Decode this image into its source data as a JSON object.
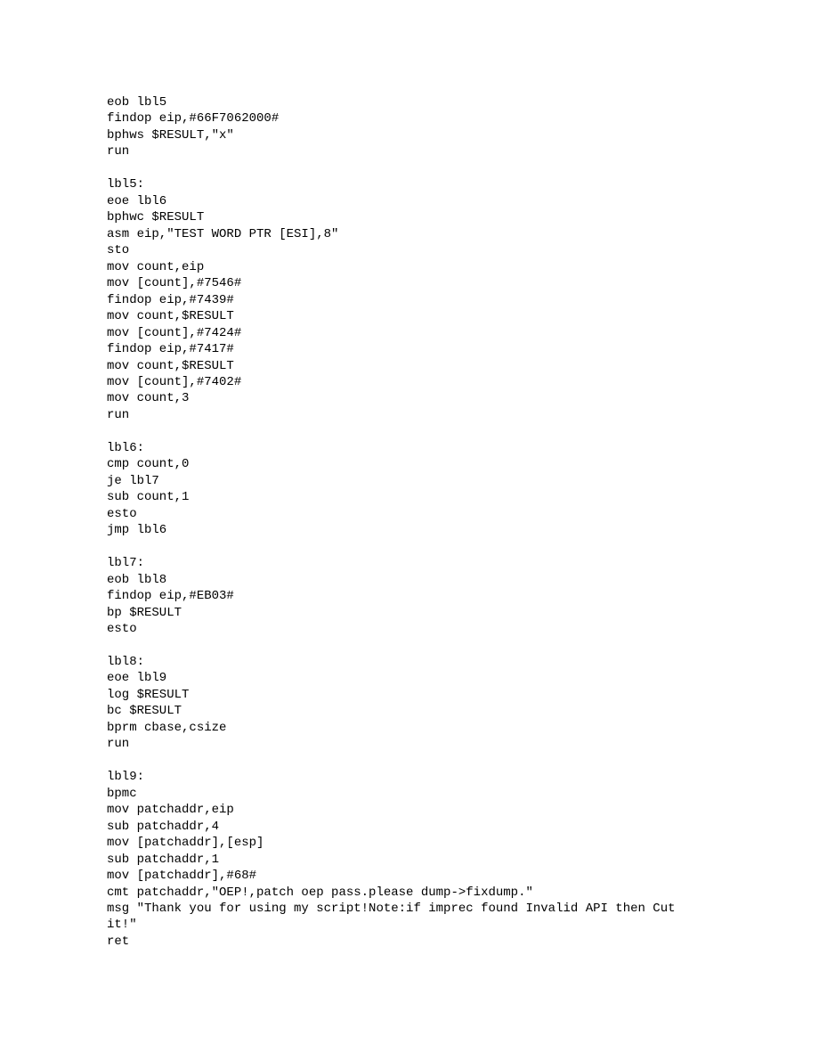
{
  "code": {
    "text": "eob lbl5\nfindop eip,#66F7062000#\nbphws $RESULT,\"x\"\nrun\n\nlbl5:\neoe lbl6\nbphwc $RESULT\nasm eip,\"TEST WORD PTR [ESI],8\"\nsto\nmov count,eip\nmov [count],#7546#\nfindop eip,#7439#\nmov count,$RESULT\nmov [count],#7424#\nfindop eip,#7417#\nmov count,$RESULT\nmov [count],#7402#\nmov count,3\nrun\n\nlbl6:\ncmp count,0\nje lbl7\nsub count,1\nesto\njmp lbl6\n\nlbl7:\neob lbl8\nfindop eip,#EB03#\nbp $RESULT\nesto\n\nlbl8:\neoe lbl9\nlog $RESULT\nbc $RESULT\nbprm cbase,csize\nrun\n\nlbl9:\nbpmc\nmov patchaddr,eip\nsub patchaddr,4\nmov [patchaddr],[esp]\nsub patchaddr,1\nmov [patchaddr],#68#\ncmt patchaddr,\"OEP!,patch oep pass.please dump->fixdump.\"\nmsg \"Thank you for using my script!Note:if imprec found Invalid API then Cut it!\"\nret"
  }
}
